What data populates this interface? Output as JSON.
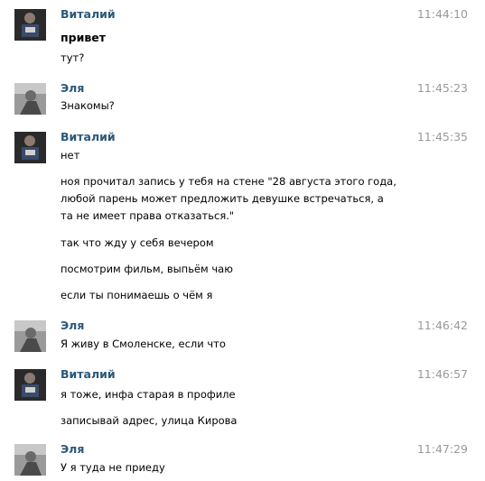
{
  "messages": [
    {
      "author": "Виталий",
      "avatar": "vitaliy-avatar",
      "time": "11:44:10",
      "lines": [
        "привет",
        "тут?"
      ]
    },
    {
      "author": "Эля",
      "avatar": "elya-avatar",
      "time": "11:45:23",
      "lines": [
        "Знакомы?"
      ]
    },
    {
      "author": "Виталий",
      "avatar": "vitaliy-avatar",
      "time": "11:45:35",
      "lines": [
        "нет",
        "ноя прочитал запись у тебя на стене \"28 августа этого года, любой парень может предложить девушке встречаться, а та не имеет права отказаться.\"",
        "так что жду у себя вечером",
        "посмотрим фильм, выпьём чаю",
        "если ты понимаешь о чём я"
      ]
    },
    {
      "author": "Эля",
      "avatar": "elya-avatar",
      "time": "11:46:42",
      "lines": [
        "Я живу в Смоленске, если что"
      ]
    },
    {
      "author": "Виталий",
      "avatar": "vitaliy-avatar",
      "time": "11:46:57",
      "lines": [
        "я тоже, инфа старая в профиле",
        "записывай адрес, улица Кирова"
      ]
    },
    {
      "author": "Эля",
      "avatar": "elya-avatar",
      "time": "11:47:29",
      "lines": [
        "У я туда не приеду"
      ]
    }
  ],
  "colors": {
    "author": "#2b587a",
    "time": "#999999",
    "text": "#000000"
  }
}
